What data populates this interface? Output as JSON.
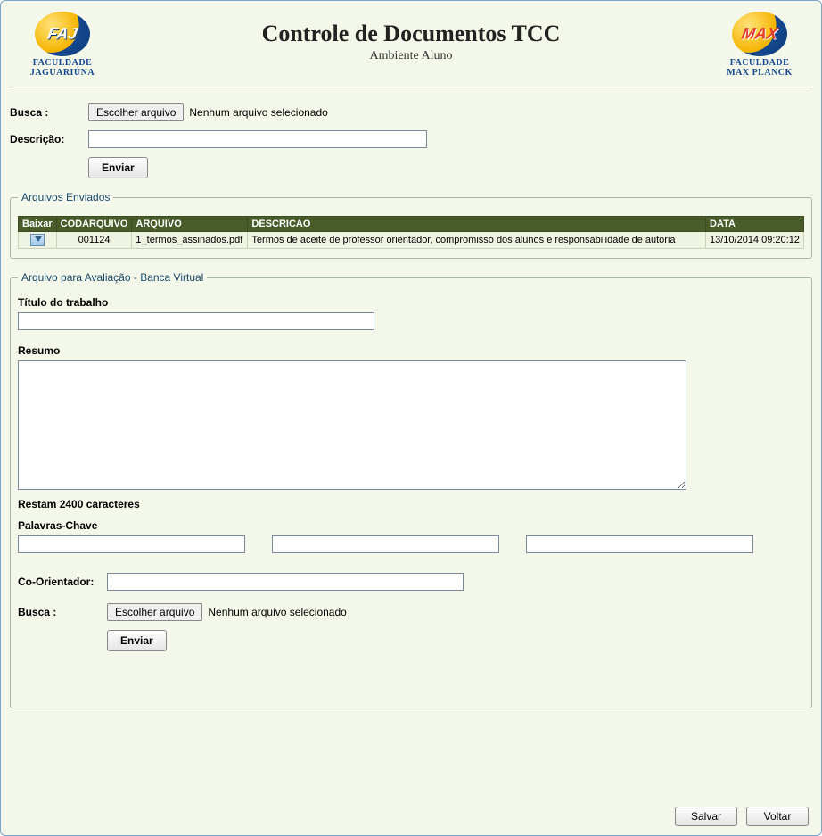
{
  "header": {
    "title": "Controle de Documentos TCC",
    "subtitle": "Ambiente Aluno",
    "logo_left_line1": "FACULDADE",
    "logo_left_line2": "JAGUARIÚNA",
    "logo_right_line1": "FACULDADE",
    "logo_right_line2": "MAX PLANCK"
  },
  "upload1": {
    "label_busca": "Busca :",
    "choose_label": "Escolher arquivo",
    "file_status": "Nenhum arquivo selecionado",
    "label_descricao": "Descrição:",
    "descricao_value": "",
    "send_label": "Enviar"
  },
  "files_group": {
    "legend": "Arquivos Enviados",
    "columns": {
      "baixar": "Baixar",
      "cod": "CODARQUIVO",
      "arquivo": "ARQUIVO",
      "descricao": "DESCRICAO",
      "data": "DATA"
    },
    "rows": [
      {
        "cod": "001124",
        "arquivo": "1_termos_assinados.pdf",
        "descricao": "Termos de aceite de professor orientador, compromisso dos alunos e responsabilidade de autoria",
        "data": "13/10/2014 09:20:12"
      }
    ]
  },
  "eval_group": {
    "legend": "Arquivo para Avaliação - Banca Virtual",
    "titulo_label": "Título do trabalho",
    "titulo_value": "",
    "resumo_label": "Resumo",
    "resumo_value": "",
    "counter_text": "Restam 2400 caracteres",
    "palavras_label": "Palavras-Chave",
    "kw1": "",
    "kw2": "",
    "kw3": "",
    "coorient_label": "Co-Orientador:",
    "coorient_value": "",
    "busca_label": "Busca :",
    "choose_label": "Escolher arquivo",
    "file_status": "Nenhum arquivo selecionado",
    "send_label": "Enviar"
  },
  "footer": {
    "save_label": "Salvar",
    "back_label": "Voltar"
  }
}
